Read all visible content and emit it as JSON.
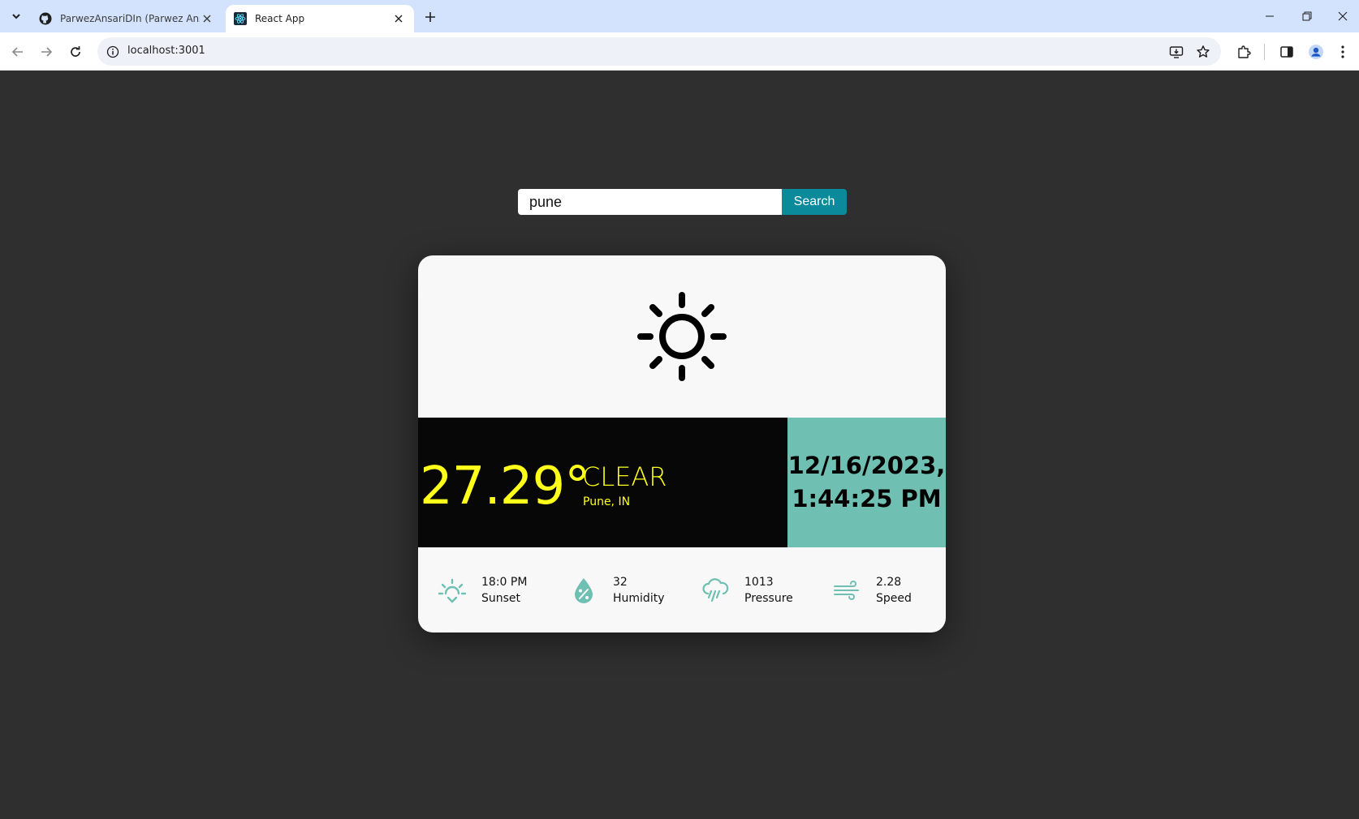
{
  "browser": {
    "tabs": [
      {
        "title": "ParwezAnsariDIn (Parwez Ansari)",
        "active": false,
        "favicon": "github-icon"
      },
      {
        "title": "React App",
        "active": true,
        "favicon": "react-icon"
      }
    ],
    "url": "localhost:3001"
  },
  "search": {
    "value": "pune",
    "button_label": "Search"
  },
  "weather": {
    "icon": "sun-icon",
    "temperature": "27.29°",
    "condition": "CLEAR",
    "location": "Pune, IN",
    "date": "12/16/2023,",
    "time": "1:44:25 PM",
    "stats": [
      {
        "icon": "sunset-icon",
        "value": "18:0 PM",
        "label": "Sunset"
      },
      {
        "icon": "humidity-icon",
        "value": "32",
        "label": "Humidity"
      },
      {
        "icon": "rain-cloud-icon",
        "value": "1013",
        "label": "Pressure"
      },
      {
        "icon": "wind-icon",
        "value": "2.28",
        "label": "Speed"
      }
    ]
  },
  "colors": {
    "page_bg": "#2f2f2f",
    "card_bg": "#f8f8f8",
    "temp_panel": "#070707",
    "temp_text": "#ffff1a",
    "date_panel": "#6fbfb2",
    "search_button": "#0b8a9c",
    "stat_icon": "#6fbfb2"
  }
}
